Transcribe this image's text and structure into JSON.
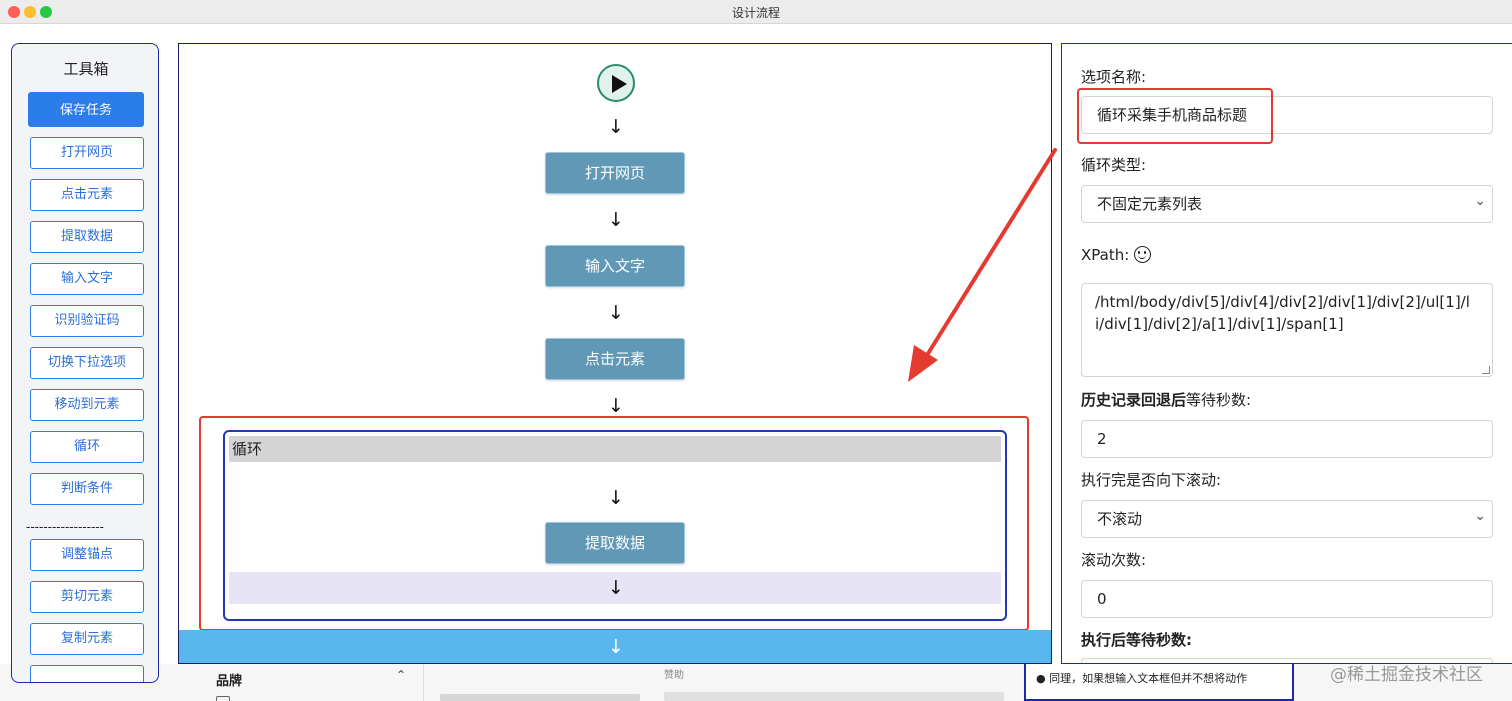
{
  "window": {
    "title": "设计流程"
  },
  "toolbox": {
    "title": "工具箱",
    "save_label": "保存任务",
    "items": [
      {
        "label": "打开网页"
      },
      {
        "label": "点击元素"
      },
      {
        "label": "提取数据"
      },
      {
        "label": "输入文字"
      },
      {
        "label": "识别验证码"
      },
      {
        "label": "切换下拉选项"
      },
      {
        "label": "移动到元素"
      },
      {
        "label": "循环"
      },
      {
        "label": "判断条件"
      }
    ],
    "separator": "------------------",
    "items2": [
      {
        "label": "调整锚点"
      },
      {
        "label": "剪切元素"
      },
      {
        "label": "复制元素"
      }
    ]
  },
  "flow": {
    "arrow": "↓",
    "nodes": [
      {
        "label": "打开网页"
      },
      {
        "label": "输入文字"
      },
      {
        "label": "点击元素"
      }
    ],
    "loop": {
      "title": "循环",
      "inner_node": "提取数据"
    }
  },
  "panel": {
    "option_name_label": "选项名称:",
    "option_name_value": "循环采集手机商品标题",
    "loop_type_label": "循环类型:",
    "loop_type_value": "不固定元素列表",
    "xpath_label": "XPath:",
    "xpath_value": "/html/body/div[5]/div[4]/div[2]/div[1]/div[2]/ul[1]/li/div[1]/div[2]/a[1]/div[1]/span[1]",
    "history_label_bold": "历史记录回退后",
    "history_label_rest": "等待秒数:",
    "history_value": "2",
    "scroll_label": "执行完是否向下滚动:",
    "scroll_value": "不滚动",
    "scroll_count_label": "滚动次数:",
    "scroll_count_value": "0",
    "after_label_bold": "执行后",
    "after_label_rest": "等待秒数:"
  },
  "background": {
    "brand_label": "品牌",
    "brand_chevron": "⌃",
    "sponsor": "赞助",
    "note": "● 同理，如果想输入文本框但并不想将动作"
  },
  "watermark": "@稀土掘金技术社区",
  "colors": {
    "accent": "#2b7de9",
    "node": "#6098b5",
    "highlight": "#e53a2f",
    "loop_border": "#2238b8",
    "bottom_bar": "#58b7ee"
  }
}
